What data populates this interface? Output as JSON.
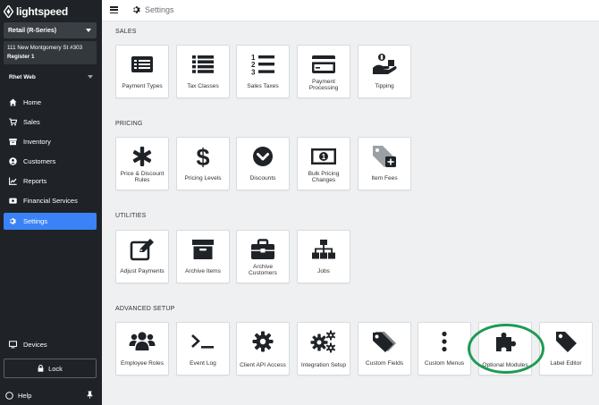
{
  "brand": {
    "name": "lightspeed"
  },
  "sidebar": {
    "store": "Retail (R-Series)",
    "address": "111 New Montgomery St #303",
    "register": "Register 1",
    "user": "Rhet Web",
    "items": [
      {
        "label": "Home",
        "icon": "home-icon"
      },
      {
        "label": "Sales",
        "icon": "cart-icon"
      },
      {
        "label": "Inventory",
        "icon": "box-icon"
      },
      {
        "label": "Customers",
        "icon": "user-icon"
      },
      {
        "label": "Reports",
        "icon": "chart-icon"
      },
      {
        "label": "Financial Services",
        "icon": "bank-icon"
      },
      {
        "label": "Settings",
        "icon": "gear-icon",
        "active": true
      }
    ],
    "devices": "Devices",
    "lock": "Lock",
    "help": "Help"
  },
  "topbar": {
    "title": "Settings"
  },
  "sections": [
    {
      "title": "SALES",
      "tiles": [
        {
          "label": "Payment Types",
          "icon": "payment-types-icon"
        },
        {
          "label": "Tax Classes",
          "icon": "list-icon"
        },
        {
          "label": "Sales Taxes",
          "icon": "numbered-list-icon"
        },
        {
          "label": "Payment Processing",
          "icon": "credit-card-icon"
        },
        {
          "label": "Tipping",
          "icon": "tip-hand-icon"
        }
      ]
    },
    {
      "title": "PRICING",
      "tiles": [
        {
          "label": "Price & Discount Rules",
          "icon": "asterisk-icon"
        },
        {
          "label": "Pricing Levels",
          "icon": "dollar-icon"
        },
        {
          "label": "Discounts",
          "icon": "chevron-circle-icon"
        },
        {
          "label": "Bulk Pricing Changes",
          "icon": "money-bill-icon"
        },
        {
          "label": "Item Fees",
          "icon": "tag-plus-icon"
        }
      ]
    },
    {
      "title": "UTILITIES",
      "tiles": [
        {
          "label": "Adjust Payments",
          "icon": "edit-icon"
        },
        {
          "label": "Archive Items",
          "icon": "archive-icon"
        },
        {
          "label": "Archive Customers",
          "icon": "briefcase-icon"
        },
        {
          "label": "Jobs",
          "icon": "sitemap-icon"
        }
      ]
    },
    {
      "title": "ADVANCED SETUP",
      "tiles": [
        {
          "label": "Employee Roles",
          "icon": "users-icon"
        },
        {
          "label": "Event Log",
          "icon": "terminal-icon"
        },
        {
          "label": "Client API Access",
          "icon": "cog-icon"
        },
        {
          "label": "Integration Setup",
          "icon": "cogs-icon"
        },
        {
          "label": "Custom Fields",
          "icon": "tags-icon"
        },
        {
          "label": "Custom Menus",
          "icon": "vertical-ellipsis-icon"
        },
        {
          "label": "Optional Modules",
          "icon": "puzzle-icon"
        },
        {
          "label": "Label Editor",
          "icon": "tag-icon"
        }
      ]
    }
  ],
  "colors": {
    "sidebar": "#1f2327",
    "active": "#3b82f6",
    "highlight": "#1f9a55",
    "icon": "#1f2327"
  }
}
